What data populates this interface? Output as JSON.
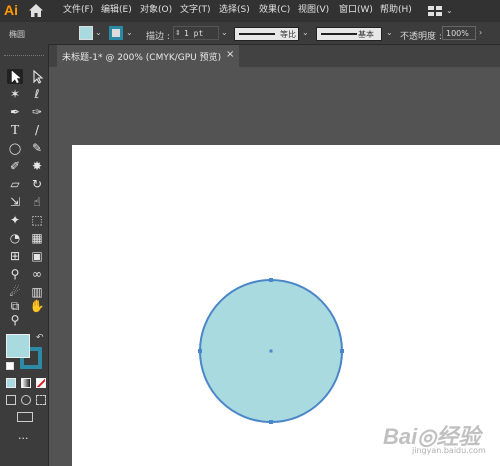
{
  "app": {
    "logo": "Ai",
    "colors": {
      "accent": "#ff9a00",
      "fill": "#a9dae0",
      "stroke": "#2b8ba6",
      "circle_outline": "#4a86c8"
    }
  },
  "menu": {
    "items": [
      "文件(F)",
      "编辑(E)",
      "对象(O)",
      "文字(T)",
      "选择(S)",
      "效果(C)",
      "视图(V)",
      "窗口(W)",
      "帮助(H)"
    ]
  },
  "control_bar": {
    "selection_label": "椭圆",
    "stroke_label": "描边 :",
    "stroke_value": "1 pt",
    "profile_label": "等比",
    "brush_label": "基本",
    "opacity_label": "不透明度 :",
    "opacity_value": "100%"
  },
  "document": {
    "tab_title": "未标题-1* @ 200% (CMYK/GPU 预览)",
    "close_glyph": "×"
  },
  "toolbar": {
    "tools": [
      {
        "name": "selection-tool-icon",
        "glyph": "▶"
      },
      {
        "name": "direct-selection-tool-icon",
        "glyph": "▷"
      },
      {
        "name": "magic-wand-tool-icon",
        "glyph": "✶"
      },
      {
        "name": "lasso-tool-icon",
        "glyph": "ℓ"
      },
      {
        "name": "pen-tool-icon",
        "glyph": "✒"
      },
      {
        "name": "curvature-tool-icon",
        "glyph": "✑"
      },
      {
        "name": "type-tool-icon",
        "glyph": "T"
      },
      {
        "name": "line-tool-icon",
        "glyph": "/"
      },
      {
        "name": "ellipse-tool-icon",
        "glyph": "◯"
      },
      {
        "name": "paintbrush-tool-icon",
        "glyph": "✎"
      },
      {
        "name": "shaper-tool-icon",
        "glyph": "✐"
      },
      {
        "name": "blob-brush-tool-icon",
        "glyph": "✸"
      },
      {
        "name": "eraser-tool-icon",
        "glyph": "▱"
      },
      {
        "name": "rotate-tool-icon",
        "glyph": "↻"
      },
      {
        "name": "scale-tool-icon",
        "glyph": "⇲"
      },
      {
        "name": "warp-tool-icon",
        "glyph": "☝"
      },
      {
        "name": "puppet-warp-tool-icon",
        "glyph": "✦"
      },
      {
        "name": "free-transform-tool-icon",
        "glyph": "⬚"
      },
      {
        "name": "shape-builder-tool-icon",
        "glyph": "◔"
      },
      {
        "name": "perspective-grid-tool-icon",
        "glyph": "▦"
      },
      {
        "name": "mesh-tool-icon",
        "glyph": "⊞"
      },
      {
        "name": "gradient-tool-icon",
        "glyph": "▣"
      },
      {
        "name": "eyedropper-tool-icon",
        "glyph": "⚲"
      },
      {
        "name": "blend-tool-icon",
        "glyph": "∞"
      },
      {
        "name": "symbol-sprayer-tool-icon",
        "glyph": "☄"
      },
      {
        "name": "column-graph-tool-icon",
        "glyph": "▥"
      },
      {
        "name": "artboard-tool-icon",
        "glyph": "⧉"
      },
      {
        "name": "slice-tool-icon",
        "glyph": "⌧"
      },
      {
        "name": "hand-tool-icon",
        "glyph": "✋"
      },
      {
        "name": "eyedropper-alt-icon",
        "glyph": "⚯"
      },
      {
        "name": "zoom-tool-icon",
        "glyph": "⚲"
      }
    ],
    "more_glyph": "···"
  },
  "watermark": {
    "text": "Bai◎经验",
    "subtext": "jingyan.baidu.com"
  }
}
